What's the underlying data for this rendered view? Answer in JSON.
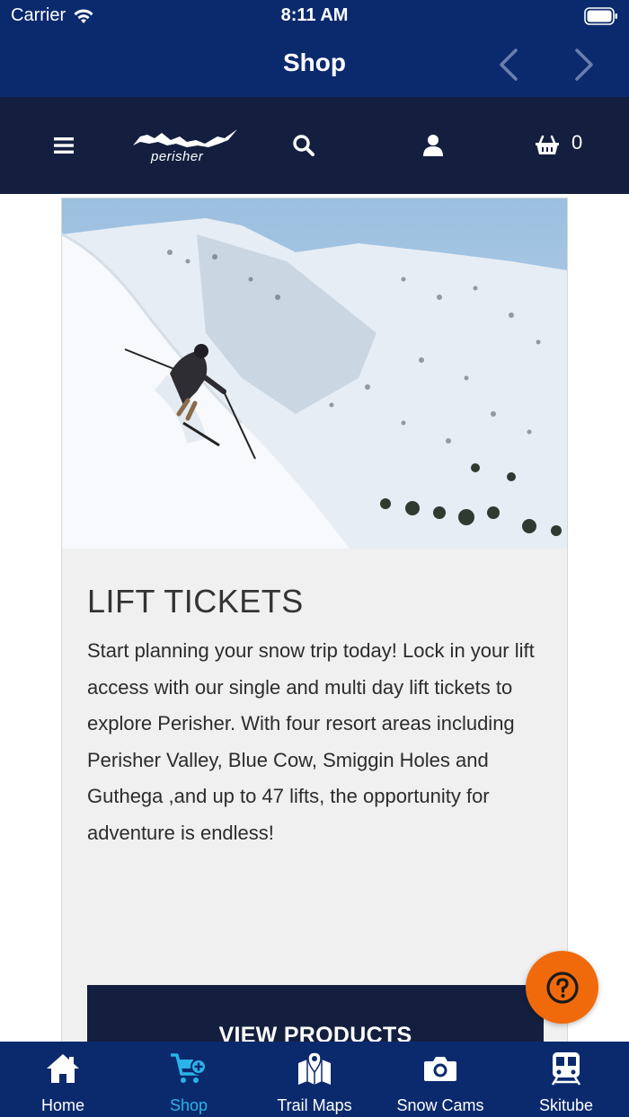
{
  "status_bar": {
    "carrier": "Carrier",
    "time": "8:11 AM"
  },
  "nav": {
    "title": "Shop"
  },
  "header": {
    "logo_text": "perisher",
    "cart_count": "0"
  },
  "card": {
    "title": "LIFT TICKETS",
    "description": "Start planning your snow trip today! Lock in your lift access with our single and multi day lift tickets to explore Perisher. With four resort areas including Perisher Valley, Blue Cow, Smiggin Holes and Guthega ,and up to 47 lifts, the opportunity for adventure is endless!",
    "button_label": "VIEW PRODUCTS"
  },
  "tabs": [
    {
      "label": "Home",
      "icon": "home-icon",
      "active": false
    },
    {
      "label": "Shop",
      "icon": "shop-cart-icon",
      "active": true
    },
    {
      "label": "Trail Maps",
      "icon": "map-icon",
      "active": false
    },
    {
      "label": "Snow Cams",
      "icon": "camera-icon",
      "active": false
    },
    {
      "label": "Skitube",
      "icon": "train-icon",
      "active": false
    }
  ],
  "colors": {
    "nav_blue": "#0b2a6e",
    "header_navy": "#141f3f",
    "fab_orange": "#f06a0c",
    "active_tab": "#2bb3e8"
  }
}
